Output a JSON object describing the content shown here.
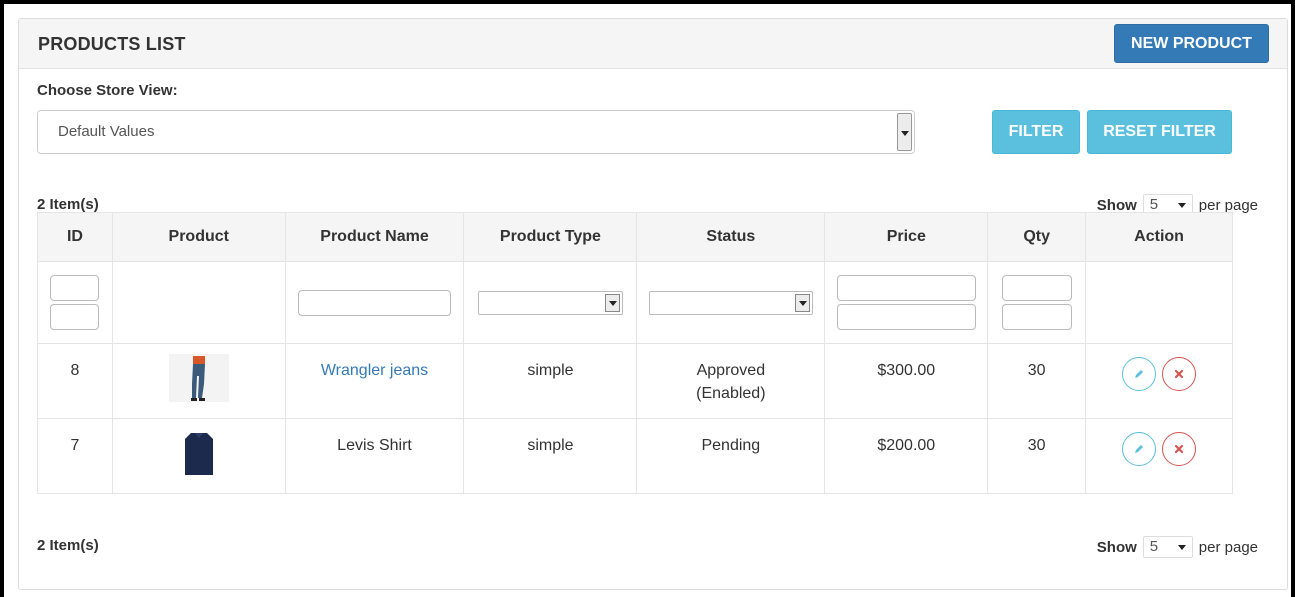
{
  "header": {
    "title": "PRODUCTS LIST",
    "new_button": "NEW PRODUCT"
  },
  "store_view": {
    "label": "Choose Store View:",
    "selected": "Default Values"
  },
  "filter_buttons": {
    "filter": "FILTER",
    "reset": "RESET FILTER"
  },
  "summary": {
    "items": "2 Item(s)",
    "show": "Show",
    "per_page_value": "5",
    "per_page": "per page"
  },
  "table": {
    "columns": [
      "ID",
      "Product",
      "Product Name",
      "Product Type",
      "Status",
      "Price",
      "Qty",
      "Action"
    ],
    "rows": [
      {
        "id": "8",
        "name": "Wrangler jeans",
        "name_is_link": true,
        "type": "simple",
        "status_line1": "Approved",
        "status_line2": "(Enabled)",
        "price": "$300.00",
        "qty": "30",
        "image": "jeans-thumbnail"
      },
      {
        "id": "7",
        "name": "Levis Shirt",
        "name_is_link": false,
        "type": "simple",
        "status_line1": "Pending",
        "status_line2": "",
        "price": "$200.00",
        "qty": "30",
        "image": "shirt-thumbnail"
      }
    ]
  },
  "colors": {
    "primary": "#337ab7",
    "info": "#5bc0de",
    "danger": "#d9534f",
    "header_bg": "#f5f5f5",
    "link": "#337ab7"
  },
  "icons": {
    "edit": "pencil-icon",
    "delete": "close-icon"
  }
}
